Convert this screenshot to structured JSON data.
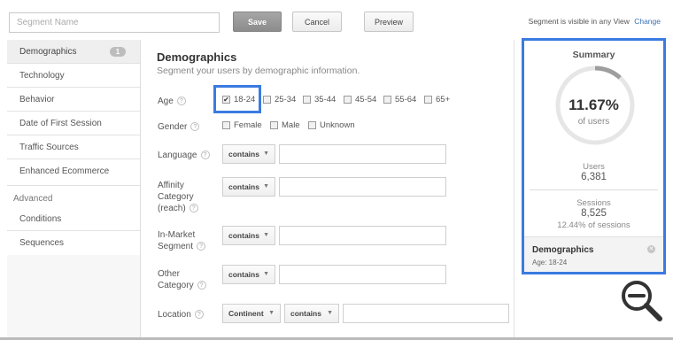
{
  "toolbar": {
    "segment_name_placeholder": "Segment Name",
    "save_label": "Save",
    "cancel_label": "Cancel",
    "preview_label": "Preview",
    "visibility_text": "Segment is visible in any View",
    "change_label": "Change"
  },
  "sidebar": {
    "items": [
      {
        "label": "Demographics",
        "badge": "1",
        "active": true
      },
      {
        "label": "Technology"
      },
      {
        "label": "Behavior"
      },
      {
        "label": "Date of First Session"
      },
      {
        "label": "Traffic Sources"
      },
      {
        "label": "Enhanced Ecommerce"
      }
    ],
    "section_label": "Advanced",
    "advanced_items": [
      {
        "label": "Conditions"
      },
      {
        "label": "Sequences"
      }
    ]
  },
  "main": {
    "title": "Demographics",
    "subtitle": "Segment your users by demographic information.",
    "age": {
      "label": "Age",
      "options": [
        {
          "label": "18-24",
          "checked": true
        },
        {
          "label": "25-34",
          "checked": false
        },
        {
          "label": "35-44",
          "checked": false
        },
        {
          "label": "45-54",
          "checked": false
        },
        {
          "label": "55-64",
          "checked": false
        },
        {
          "label": "65+",
          "checked": false
        }
      ]
    },
    "gender": {
      "label": "Gender",
      "options": [
        {
          "label": "Female",
          "checked": false
        },
        {
          "label": "Male",
          "checked": false
        },
        {
          "label": "Unknown",
          "checked": false
        }
      ]
    },
    "language": {
      "label": "Language",
      "operator": "contains"
    },
    "affinity": {
      "label_lines": [
        "Affinity",
        "Category",
        "(reach)"
      ],
      "operator": "contains"
    },
    "inmarket": {
      "label_lines": [
        "In-Market",
        "Segment"
      ],
      "operator": "contains"
    },
    "other": {
      "label_lines": [
        "Other",
        "Category"
      ],
      "operator": "contains"
    },
    "location": {
      "label": "Location",
      "dimension": "Continent",
      "operator": "contains"
    }
  },
  "summary": {
    "title": "Summary",
    "percent": "11.67%",
    "percent_sub": "of users",
    "percent_value": 0.1167,
    "users_label": "Users",
    "users_value": "6,381",
    "sessions_label": "Sessions",
    "sessions_value": "8,525",
    "sessions_pct": "12.44% of sessions",
    "footer_title": "Demographics",
    "footer_sub": "Age: 18-24"
  },
  "colors": {
    "highlight": "#3b7be0",
    "donut_track": "#e6e6e6",
    "donut_fill": "#9e9e9e",
    "link": "#3a6fb5"
  },
  "icons": {
    "help": "question-icon",
    "zoom": "magnifier-zoom-out-icon",
    "remove": "close-icon",
    "caret": "caret-down-icon"
  }
}
